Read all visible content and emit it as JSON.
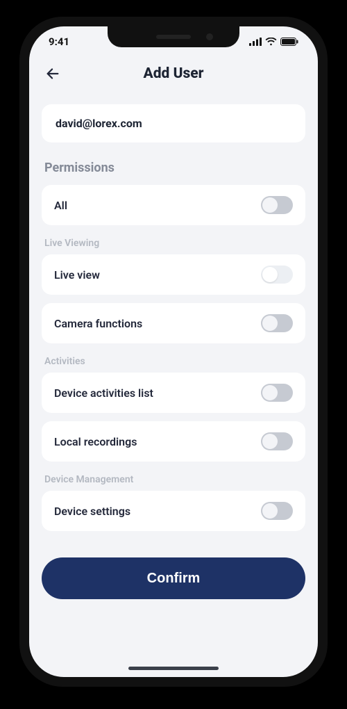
{
  "status": {
    "time": "9:41"
  },
  "header": {
    "title": "Add User"
  },
  "email": {
    "value": "david@lorex.com"
  },
  "permissions": {
    "title": "Permissions",
    "all_label": "All",
    "sections": {
      "live": {
        "title": "Live Viewing",
        "live_view": "Live view",
        "camera_functions": "Camera functions"
      },
      "activities": {
        "title": "Activities",
        "device_activities": "Device activities list",
        "local_recordings": "Local recordings"
      },
      "device_mgmt": {
        "title": "Device Management",
        "device_settings": "Device settings"
      }
    }
  },
  "footer": {
    "confirm_label": "Confirm"
  },
  "colors": {
    "accent": "#1e3266"
  }
}
